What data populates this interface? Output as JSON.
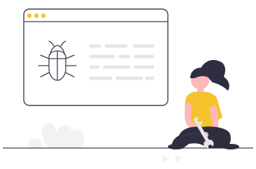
{
  "illustration": {
    "subject": "bug-fixing",
    "colors": {
      "accent": "#F5C32C",
      "outline": "#3F3D56",
      "code_line": "#E6E6E6",
      "skin": "#FFB8B8",
      "hair": "#2F2E41",
      "shirt": "#F5C32C",
      "pants": "#2F2E41",
      "leaf": "#F2F2F2",
      "ground": "#3F3D56"
    },
    "window": {
      "dots": [
        "dot-1",
        "dot-2",
        "dot-3"
      ],
      "icon": "bug-icon",
      "code_lines": 4
    },
    "person": {
      "tool": "wrench-icon"
    }
  }
}
